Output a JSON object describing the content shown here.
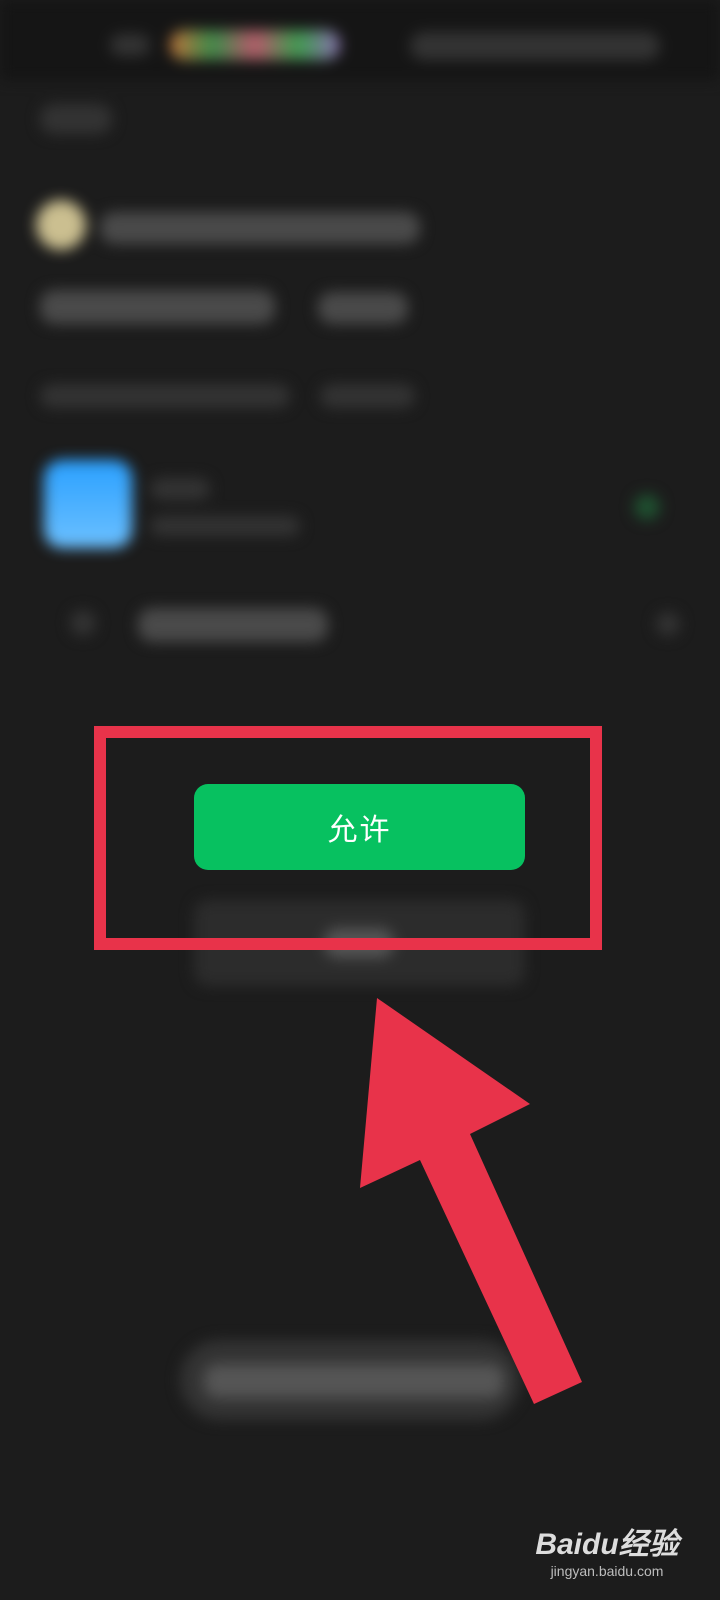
{
  "dialog": {
    "allow_label": "允许"
  },
  "colors": {
    "background": "#1c1c1c",
    "allow_button": "#07c160",
    "highlight": "#e8334a"
  },
  "icons": {
    "annotation_arrow": "arrow-up-icon",
    "watermark_logo": "baidu-paw-icon"
  },
  "watermark": {
    "logo_text": "Baidu经验",
    "url": "jingyan.baidu.com"
  }
}
